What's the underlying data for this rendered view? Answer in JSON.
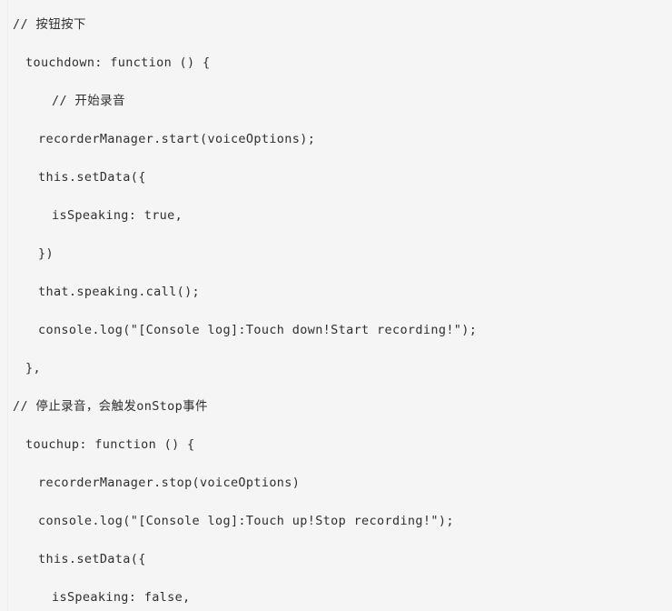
{
  "editor": {
    "background_color": "#f5f5f5",
    "text_color": "#2f2f2f",
    "gutter_rule_color": "#ededed",
    "language": "javascript"
  },
  "code": {
    "lines": [
      {
        "indent": 0,
        "text": "// 按钮按下"
      },
      {
        "indent": 1,
        "text": "touchdown: function () {"
      },
      {
        "indent": 3,
        "text": "// 开始录音"
      },
      {
        "indent": 2,
        "text": "recorderManager.start(voiceOptions);"
      },
      {
        "indent": 2,
        "text": "this.setData({"
      },
      {
        "indent": 3,
        "text": "isSpeaking: true,"
      },
      {
        "indent": 2,
        "text": "})"
      },
      {
        "indent": 2,
        "text": "that.speaking.call();"
      },
      {
        "indent": 2,
        "text": "console.log(\"[Console log]:Touch down!Start recording!\");"
      },
      {
        "indent": 1,
        "text": "},"
      },
      {
        "indent": 0,
        "text": "// 停止录音，会触发onStop事件"
      },
      {
        "indent": 1,
        "text": "touchup: function () {"
      },
      {
        "indent": 2,
        "text": "recorderManager.stop(voiceOptions)"
      },
      {
        "indent": 2,
        "text": "console.log(\"[Console log]:Touch up!Stop recording!\");"
      },
      {
        "indent": 2,
        "text": "this.setData({"
      },
      {
        "indent": 3,
        "text": "isSpeaking: false,"
      }
    ]
  }
}
